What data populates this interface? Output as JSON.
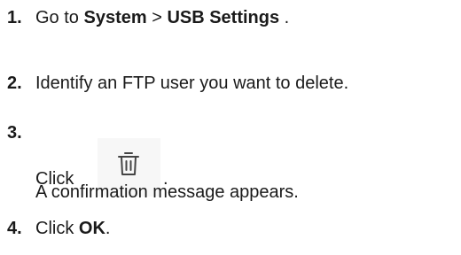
{
  "steps": [
    {
      "number": "1.",
      "pre": "Go to ",
      "bold1": "System",
      "sep": " > ",
      "bold2": "USB Settings",
      "post": " ."
    },
    {
      "number": "2.",
      "text": "Identify an FTP user you want to delete."
    },
    {
      "number": "3.",
      "click": "Click",
      "icon": "trash-icon",
      "period": ".",
      "result": "A confirmation message appears."
    },
    {
      "number": "4.",
      "pre": "Click ",
      "bold": "OK",
      "post": "."
    }
  ]
}
